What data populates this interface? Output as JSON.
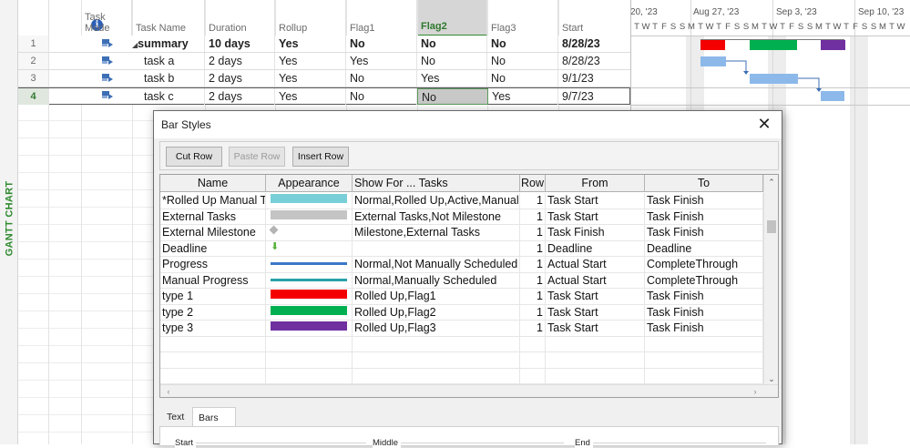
{
  "app": {
    "view_label": "GANTT CHART"
  },
  "grid": {
    "columns": [
      "",
      "Task Mode",
      "Task Name",
      "Duration",
      "Rollup",
      "Flag1",
      "Flag2",
      "Flag3",
      "Start"
    ],
    "info_icon": "info-icon",
    "selected_column": "Flag2",
    "rows": [
      {
        "id": "1",
        "name": "summary",
        "duration": "10 days",
        "rollup": "Yes",
        "flag1": "No",
        "flag2": "No",
        "flag3": "No",
        "start": "8/28/23",
        "summary": true
      },
      {
        "id": "2",
        "name": "task a",
        "duration": "2 days",
        "rollup": "Yes",
        "flag1": "Yes",
        "flag2": "No",
        "flag3": "No",
        "start": "8/28/23",
        "summary": false
      },
      {
        "id": "3",
        "name": "task b",
        "duration": "2 days",
        "rollup": "Yes",
        "flag1": "No",
        "flag2": "Yes",
        "flag3": "No",
        "start": "9/1/23",
        "summary": false
      },
      {
        "id": "4",
        "name": "task c",
        "duration": "2 days",
        "rollup": "Yes",
        "flag1": "No",
        "flag2": "No",
        "flag3": "Yes",
        "start": "9/7/23",
        "summary": false,
        "active": true
      }
    ]
  },
  "gantt": {
    "weeks": [
      "20, '23",
      "Aug 27, '23",
      "Sep 3, '23",
      "Sep 10, '23"
    ],
    "day_letters": [
      "T",
      "W",
      "T",
      "F",
      "S",
      "S",
      "M",
      "T",
      "W",
      "T",
      "F",
      "S",
      "S",
      "M",
      "T",
      "W",
      "T",
      "F",
      "S",
      "S",
      "M",
      "T",
      "W",
      "T",
      "F",
      "S",
      "S",
      "M",
      "T",
      "W"
    ],
    "colors": {
      "type1": "#f40000",
      "type2": "#00b050",
      "type3": "#7030a0",
      "task": "#8db9ea",
      "summary_line": "#7a7a7a"
    }
  },
  "dialog": {
    "title": "Bar Styles",
    "close_icon": "close-icon",
    "buttons": {
      "cut": "Cut Row",
      "paste": "Paste Row",
      "insert": "Insert Row"
    },
    "columns": [
      "Name",
      "Appearance",
      "Show For ... Tasks",
      "Row",
      "From",
      "To"
    ],
    "rows": [
      {
        "name": "*Rolled Up Manual Ta",
        "appearance": "bar",
        "color": "#79cfd8",
        "show_for": "Normal,Rolled Up,Active,Manually",
        "row": "1",
        "from": "Task Start",
        "to": "Task Finish"
      },
      {
        "name": "External Tasks",
        "appearance": "bar",
        "color": "#c4c4c4",
        "show_for": "External Tasks,Not Milestone",
        "row": "1",
        "from": "Task Start",
        "to": "Task Finish"
      },
      {
        "name": "External Milestone",
        "appearance": "diamond",
        "color": "#b4b4b4",
        "show_for": "Milestone,External Tasks",
        "row": "1",
        "from": "Task Finish",
        "to": "Task Finish"
      },
      {
        "name": "Deadline",
        "appearance": "arrow",
        "color": "#58b03a",
        "show_for": "",
        "row": "1",
        "from": "Deadline",
        "to": "Deadline"
      },
      {
        "name": "Progress",
        "appearance": "line",
        "color": "#3b78c8",
        "show_for": "Normal,Not Manually Scheduled",
        "row": "1",
        "from": "Actual Start",
        "to": "CompleteThrough"
      },
      {
        "name": "Manual Progress",
        "appearance": "line",
        "color": "#2aa0a8",
        "show_for": "Normal,Manually Scheduled",
        "row": "1",
        "from": "Actual Start",
        "to": "CompleteThrough"
      },
      {
        "name": "type 1",
        "appearance": "bar",
        "color": "#f40000",
        "show_for": "Rolled Up,Flag1",
        "row": "1",
        "from": "Task Start",
        "to": "Task Finish"
      },
      {
        "name": "type 2",
        "appearance": "bar",
        "color": "#00b050",
        "show_for": "Rolled Up,Flag2",
        "row": "1",
        "from": "Task Start",
        "to": "Task Finish"
      },
      {
        "name": "type 3",
        "appearance": "bar",
        "color": "#7030a0",
        "show_for": "Rolled Up,Flag3",
        "row": "1",
        "from": "Task Start",
        "to": "Task Finish"
      }
    ],
    "tabs": [
      "Text",
      "Bars"
    ],
    "active_tab": "Bars",
    "bar_groups": [
      "Start",
      "Middle",
      "End"
    ]
  }
}
